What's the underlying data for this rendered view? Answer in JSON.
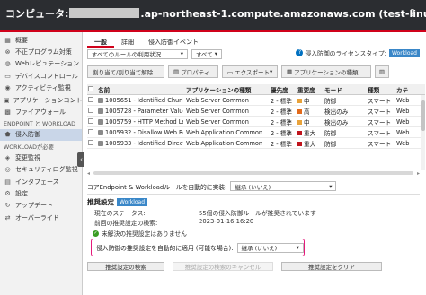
{
  "window": {
    "title_prefix": "コンピュータ:",
    "title_suffix": ".ap-northeast-1.compute.amazonaws.com (test-linux)",
    "help_icon": "help-icon"
  },
  "sidebar": {
    "items": [
      {
        "label": "概要",
        "icon": "overview-icon"
      },
      {
        "label": "不正プログラム対策",
        "icon": "antimalware-icon"
      },
      {
        "label": "Webレピュテーション",
        "icon": "globe-icon"
      },
      {
        "label": "デバイスコントロール",
        "icon": "device-icon"
      },
      {
        "label": "アクティビティ監視",
        "icon": "activity-icon"
      },
      {
        "label": "アプリケーションコント",
        "icon": "app-control-icon"
      },
      {
        "label": "ファイアウォール",
        "icon": "firewall-icon"
      }
    ],
    "section1": "ENDPOINT と WORKLOAD",
    "active_item": {
      "label": "侵入防御",
      "icon": "shield-icon"
    },
    "section2": "WORKLOADが必要",
    "items2": [
      {
        "label": "変更監視",
        "icon": "integrity-icon"
      },
      {
        "label": "セキュリティログ監視",
        "icon": "log-icon"
      },
      {
        "label": "インタフェース",
        "icon": "interface-icon"
      },
      {
        "label": "設定",
        "icon": "gear-icon"
      },
      {
        "label": "アップデート",
        "icon": "update-icon"
      },
      {
        "label": "オーバーライド",
        "icon": "override-icon"
      }
    ]
  },
  "tabs": [
    "一般",
    "詳細",
    "侵入防御イベント"
  ],
  "filters": {
    "rule_filter": "すべてのルールの利用状況",
    "all_filter": "すべて",
    "license_label": "侵入防御のライセンスタイプ:",
    "license_badge": "Workload"
  },
  "toolbar": {
    "assign": "割り当て/割り当て解除...",
    "properties": "プロパティ...",
    "export": "エクスポート",
    "app_types": "アプリケーションの種類..."
  },
  "table": {
    "headers": [
      "名前",
      "アプリケーションの種類",
      "優先度",
      "重要度",
      "モード",
      "種類",
      "カテ"
    ],
    "rows": [
      {
        "name": "1005651 - Identified Chunked T...",
        "app": "Web Server Common",
        "priority": "2 - 標準",
        "severity": "中",
        "sev_color": "#e8a23a",
        "mode": "防御",
        "type": "スマート",
        "cat": "Web"
      },
      {
        "name": "1005728 - Parameter Value Len...",
        "app": "Web Server Common",
        "priority": "2 - 標準",
        "severity": "高",
        "sev_color": "#e26a1b",
        "mode": "検出のみ",
        "type": "スマート",
        "cat": "Web"
      },
      {
        "name": "1005759 - HTTP Method Lengt...",
        "app": "Web Server Common",
        "priority": "2 - 標準",
        "severity": "中",
        "sev_color": "#e8a23a",
        "mode": "検出のみ",
        "type": "スマート",
        "cat": "Web"
      },
      {
        "name": "1005932 - Disallow Web Resou...",
        "app": "Web Application Common",
        "priority": "2 - 標準",
        "severity": "重大",
        "sev_color": "#c0141c",
        "mode": "防御",
        "type": "スマート",
        "cat": "Web"
      },
      {
        "name": "1005933 - Identified Directory T...",
        "app": "Web Application Common",
        "priority": "2 - 標準",
        "severity": "重大",
        "sev_color": "#c0141c",
        "mode": "防御",
        "type": "スマート",
        "cat": "Web"
      }
    ]
  },
  "auto_apply": {
    "label": "コアEndpoint & Workloadルールを自動的に実装:",
    "value": "継承 (いいえ)"
  },
  "recommend": {
    "title": "推奨設定",
    "badge": "Workload",
    "status_label": "現在のステータス:",
    "status_value": "55個の侵入防御ルールが推奨されています",
    "last_label": "前回の推奨設定の検索:",
    "last_value": "2023-01-16 16:20",
    "ok_text": "未解決の推奨設定はありません",
    "auto_label": "侵入防御の推奨設定を自動的に適用 (可能な場合):",
    "auto_value": "継承 (いいえ)",
    "btn_search": "推奨設定の検索",
    "btn_cancel": "推奨設定の検索のキャンセル",
    "btn_clear": "推奨設定をクリア"
  },
  "colors": {
    "accent": "#d0021b",
    "highlight": "#e5197a",
    "badge": "#3a87c8",
    "ok": "#3a9d23"
  }
}
